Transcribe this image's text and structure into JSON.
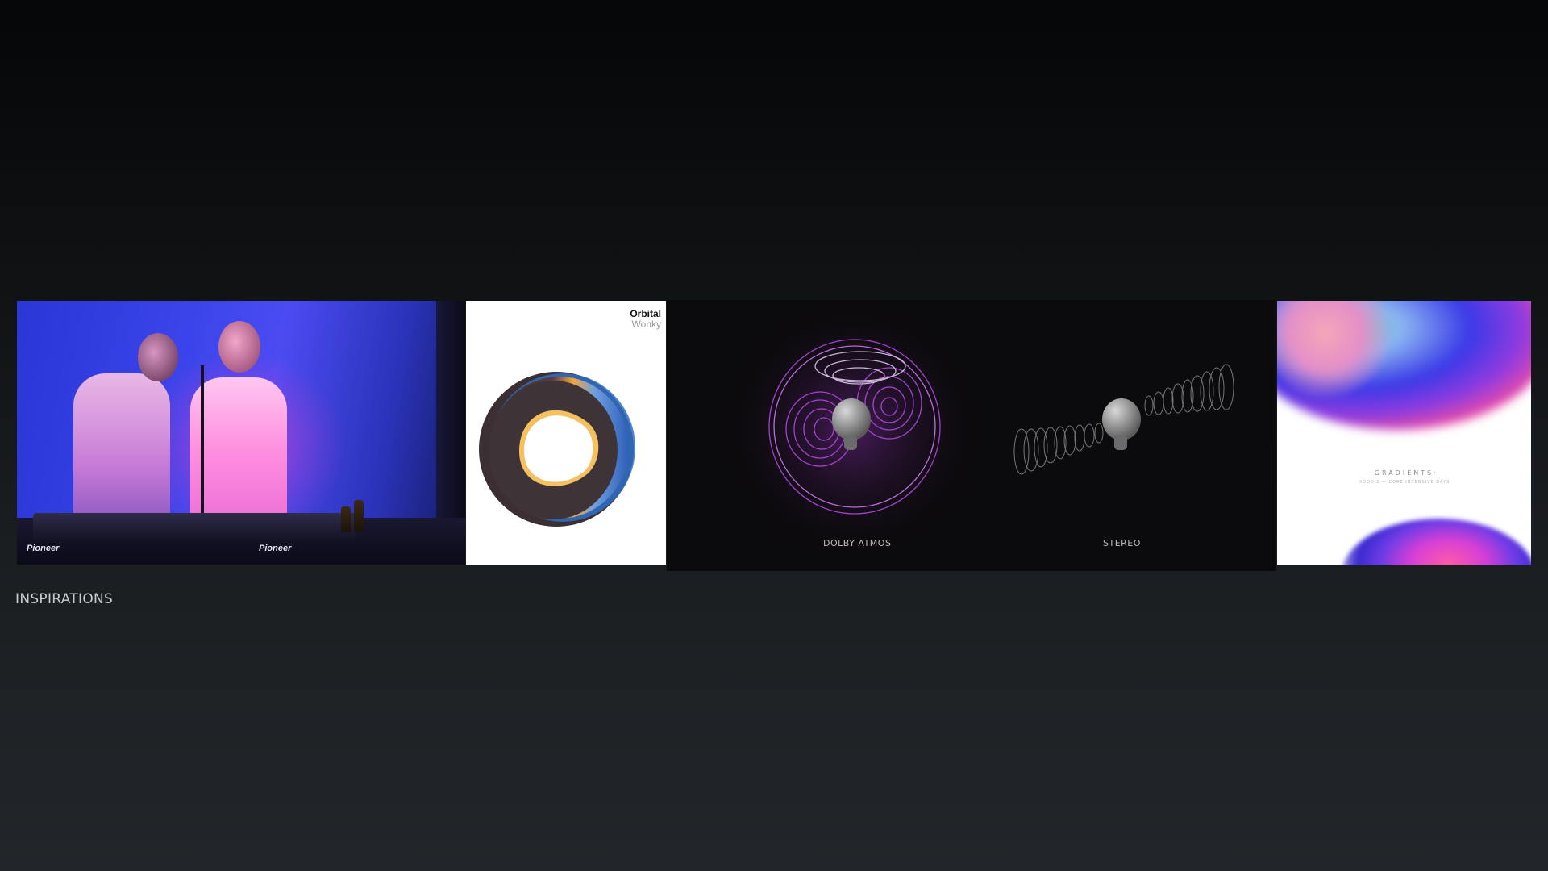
{
  "section": {
    "label": "INSPIRATIONS"
  },
  "panels": {
    "dj_photo": {
      "deck_brand": "Pioneer"
    },
    "album": {
      "artist": "Orbital",
      "title": "Wonky"
    },
    "spatial_audio": {
      "left_caption": "DOLBY ATMOS",
      "right_caption": "STEREO"
    },
    "gradients": {
      "title": "·GRADIENTS·",
      "subtitle": "MOOD 3 — CORE INTENSIVE DAYS"
    }
  },
  "colors": {
    "background_top": "#050607",
    "background_bottom": "#22262a",
    "label_text": "#c9cdd1",
    "atmos_purple": "#b04adf"
  }
}
